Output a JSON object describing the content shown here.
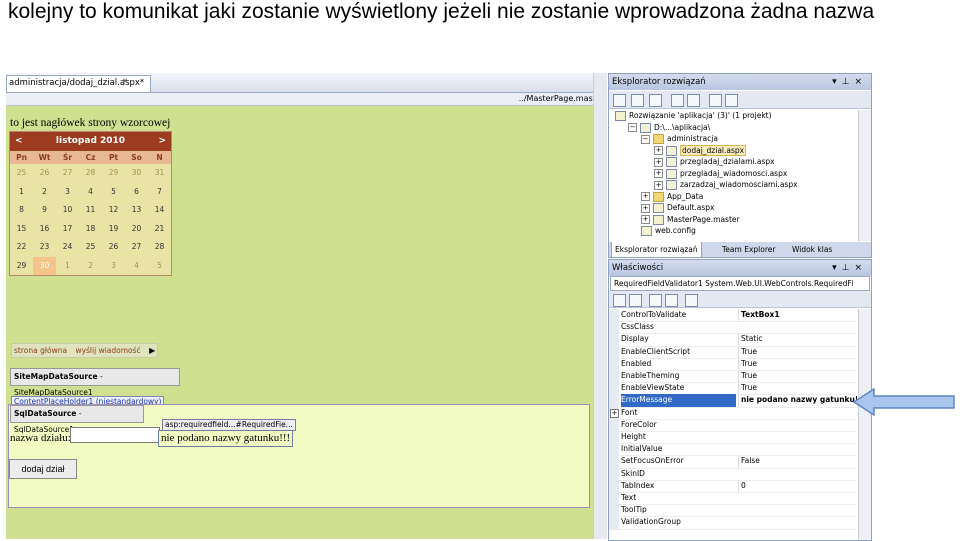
{
  "slide": {
    "title": "kolejny to komunikat jaki zostanie wyświetlony jeżeli nie zostanie wprowadzona żadna nazwa"
  },
  "designer": {
    "doc_tab": "administracja/dodaj_dzial.aspx*",
    "close_glyph": "×",
    "master_link": "../MasterPage.master",
    "header_text": "to jest nagłówek strony wzorcowej",
    "calendar": {
      "prev": "<",
      "next": ">",
      "month": "listopad 2010",
      "days_of_week": [
        "Pn",
        "Wt",
        "Śr",
        "Cz",
        "Pt",
        "So",
        "N"
      ],
      "weeks": [
        [
          "25",
          "26",
          "27",
          "28",
          "29",
          "30",
          "31"
        ],
        [
          "1",
          "2",
          "3",
          "4",
          "5",
          "6",
          "7"
        ],
        [
          "8",
          "9",
          "10",
          "11",
          "12",
          "13",
          "14"
        ],
        [
          "15",
          "16",
          "17",
          "18",
          "19",
          "20",
          "21"
        ],
        [
          "22",
          "23",
          "24",
          "25",
          "26",
          "27",
          "28"
        ],
        [
          "29",
          "30",
          "1",
          "2",
          "3",
          "4",
          "5"
        ]
      ]
    },
    "menu": {
      "item1": "strona główna",
      "item2": "wyślij wiadomość",
      "arrow": "▶"
    },
    "sitemap_ds": {
      "type": "SiteMapDataSource",
      "name": " - SiteMapDataSource1"
    },
    "placeholder_label": "ContentPlaceHolder1 (niestandardowy)",
    "sql_ds": {
      "type": "SqlDataSource",
      "name": " - SqlDataSource1"
    },
    "field_label": "nazwa działu:",
    "validator_tag": "asp:requiredfield...#RequiredFie...",
    "validator_message": "nie podano nazwy gatunku!!!",
    "add_button": "dodaj dział"
  },
  "solution_explorer": {
    "title": "Eksplorator rozwiązań",
    "ctrl_pin": "▾",
    "ctrl_autohide": "⊥",
    "ctrl_close": "×",
    "tree": [
      {
        "indent": 0,
        "pm": "",
        "icon": "solution",
        "label": "Rozwiązanie 'aplikacja' (3)' (1 projekt)"
      },
      {
        "indent": 1,
        "pm": "−",
        "icon": "project",
        "label": "D:\\...\\aplikacja\\"
      },
      {
        "indent": 2,
        "pm": "−",
        "icon": "folder",
        "label": "administracja"
      },
      {
        "indent": 3,
        "pm": "+",
        "icon": "file",
        "label": "dodaj_dzial.aspx",
        "selected": true
      },
      {
        "indent": 3,
        "pm": "+",
        "icon": "file",
        "label": "przegladaj_dzialami.aspx"
      },
      {
        "indent": 3,
        "pm": "+",
        "icon": "file",
        "label": "przegladaj_wiadomosci.aspx"
      },
      {
        "indent": 3,
        "pm": "+",
        "icon": "file",
        "label": "zarzadzaj_wiadomosciami.aspx"
      },
      {
        "indent": 2,
        "pm": "+",
        "icon": "folder",
        "label": "App_Data"
      },
      {
        "indent": 2,
        "pm": "+",
        "icon": "file",
        "label": "Default.aspx"
      },
      {
        "indent": 2,
        "pm": "+",
        "icon": "file",
        "label": "MasterPage.master"
      },
      {
        "indent": 2,
        "pm": "",
        "icon": "file",
        "label": "web.config"
      }
    ],
    "tabs": [
      "Eksplorator rozwiązań",
      "Team Explorer",
      "Widok klas"
    ]
  },
  "properties": {
    "title": "Właściwości",
    "object": "RequiredFieldValidator1 System.Web.UI.WebControls.RequiredFi",
    "rows": [
      {
        "name": "ControlToValidate",
        "value": "TextBox1",
        "bold": true
      },
      {
        "name": "CssClass",
        "value": ""
      },
      {
        "name": "Display",
        "value": "Static"
      },
      {
        "name": "EnableClientScript",
        "value": "True"
      },
      {
        "name": "Enabled",
        "value": "True"
      },
      {
        "name": "EnableTheming",
        "value": "True"
      },
      {
        "name": "EnableViewState",
        "value": "True"
      },
      {
        "name": "ErrorMessage",
        "value": "nie podano nazwy gatunku!!!",
        "selected": true
      },
      {
        "name": "Font",
        "value": "",
        "expander": "+"
      },
      {
        "name": "ForeColor",
        "value": ""
      },
      {
        "name": "Height",
        "value": ""
      },
      {
        "name": "InitialValue",
        "value": ""
      },
      {
        "name": "SetFocusOnError",
        "value": "False"
      },
      {
        "name": "SkinID",
        "value": ""
      },
      {
        "name": "TabIndex",
        "value": "0"
      },
      {
        "name": "Text",
        "value": ""
      },
      {
        "name": "ToolTip",
        "value": ""
      },
      {
        "name": "ValidationGroup",
        "value": ""
      }
    ]
  },
  "colors": {
    "designer_bg": "#cfe090",
    "calendar_header": "#9c3b1f",
    "selection": "#3169c6",
    "pointer_arrow": "#a9c6ee"
  }
}
